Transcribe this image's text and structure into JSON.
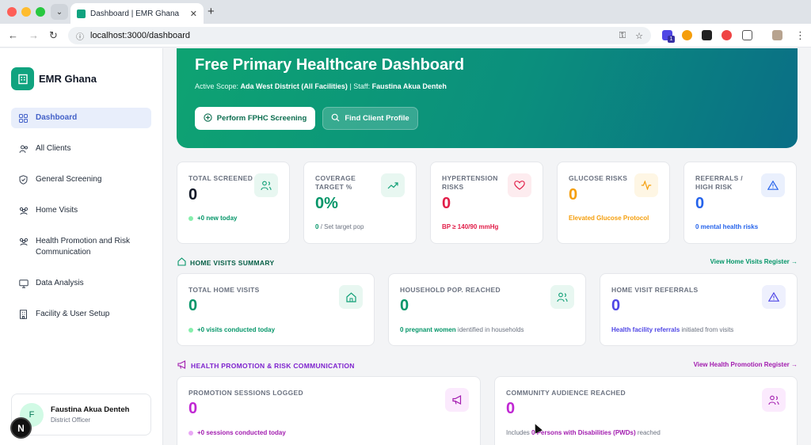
{
  "browser": {
    "tab_title": "Dashboard | EMR Ghana",
    "url": "localhost:3000/dashboard",
    "ext_badge": "1"
  },
  "sidebar": {
    "brand": "EMR Ghana",
    "items": [
      {
        "label": "Dashboard",
        "icon": "grid-icon"
      },
      {
        "label": "All Clients",
        "icon": "users-icon"
      },
      {
        "label": "General Screening",
        "icon": "shield-icon"
      },
      {
        "label": "Home Visits",
        "icon": "users-icon"
      },
      {
        "label": "Health Promotion and Risk Communication",
        "icon": "users-icon"
      },
      {
        "label": "Data Analysis",
        "icon": "monitor-icon"
      },
      {
        "label": "Facility & User Setup",
        "icon": "building-icon"
      }
    ],
    "user": {
      "initial": "F",
      "name": "Faustina Akua Denteh",
      "role": "District Officer"
    },
    "next_badge": "N"
  },
  "hero": {
    "title": "Free Primary Healthcare Dashboard",
    "scope_label": "Active Scope:",
    "scope_value": "Ada West District (All Facilities)",
    "staff_label": "| Staff:",
    "staff_value": "Faustina Akua Denteh",
    "primary_button": "Perform FPHC Screening",
    "secondary_button": "Find Client Profile"
  },
  "stats": [
    {
      "label": "TOTAL SCREENED",
      "value": "0",
      "foot": "+0 new today",
      "color": "#059669"
    },
    {
      "label": "COVERAGE TARGET %",
      "value": "0%",
      "foot_value": "0",
      "foot": "/ Set target pop",
      "color": "#059669"
    },
    {
      "label": "HYPERTENSION RISKS",
      "value": "0",
      "foot": "BP ≥ 140/90 mmHg",
      "color": "#e11d48"
    },
    {
      "label": "GLUCOSE RISKS",
      "value": "0",
      "foot": "Elevated Glucose Protocol",
      "color": "#f59e0b"
    },
    {
      "label": "REFERRALS / HIGH RISK",
      "value": "0",
      "foot": "0 mental health risks",
      "color": "#2563eb"
    }
  ],
  "home_visits": {
    "title": "HOME VISITS SUMMARY",
    "link": "View Home Visits Register →",
    "cards": [
      {
        "label": "TOTAL HOME VISITS",
        "value": "0",
        "foot_strong": "+0 visits conducted today",
        "foot": ""
      },
      {
        "label": "HOUSEHOLD POP. REACHED",
        "value": "0",
        "foot_strong": "0 pregnant women",
        "foot": "identified in households"
      },
      {
        "label": "HOME VISIT REFERRALS",
        "value": "0",
        "foot_strong": "Health facility referrals",
        "foot": "initiated from visits"
      }
    ]
  },
  "promotion": {
    "title": "HEALTH PROMOTION & RISK COMMUNICATION",
    "link": "View Health Promotion Register →",
    "cards": [
      {
        "label": "PROMOTION SESSIONS LOGGED",
        "value": "0",
        "foot_strong": "+0 sessions conducted today"
      },
      {
        "label": "COMMUNITY AUDIENCE REACHED",
        "value": "0",
        "foot_pre": "Includes",
        "foot_strong": "0 Persons with Disabilities (PWDs)",
        "foot": "reached"
      }
    ]
  }
}
